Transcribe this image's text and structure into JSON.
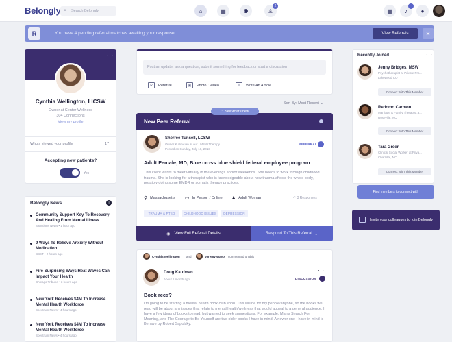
{
  "nav": {
    "logo": "Belongly",
    "search_placeholder": "Search Belongly",
    "referral_badge": "2"
  },
  "banner": {
    "initial": "R",
    "text": "You have 4 pending referral matches awaiting your response",
    "button": "View Referrals",
    "close": "✕"
  },
  "profile": {
    "name": "Cynthia Wellington, LICSW",
    "title": "Owner at Center Wellness",
    "connections": "304 Connections",
    "view_profile": "View my profile",
    "viewed_label": "Who's viewed your profile",
    "viewed_count": "17",
    "accepting_label": "Accepting new patients?",
    "toggle_label": "Yes"
  },
  "news": {
    "title": "Belongly News",
    "items": [
      {
        "title": "Community Support Key To Recovery And Healing From Mental Illness",
        "source": "Sanctions News • 1 hour ago"
      },
      {
        "title": "9 Ways To Relieve Anxiety Without Medication",
        "source": "BBET • 2 hours ago"
      },
      {
        "title": "Fire Surprising Ways Heat Waves Can Impact Your Health",
        "source": "Chicago Tribune • 3 hours ago"
      },
      {
        "title": "New York Receives $4M To Increase Mental Health Workforce",
        "source": "Spectrum News • 4 hours ago"
      },
      {
        "title": "New York Receives $4M To Increase Mental Health Workforce",
        "source": "Spectrum News • 4 hours ago"
      }
    ]
  },
  "composer": {
    "placeholder": "Post an update, ask a question, submit something for feedback or start a discussion",
    "actions": [
      "Referral",
      "Photo / Video",
      "Write An Article"
    ],
    "sort": "Sort By: Most Recent",
    "see_more": "See what's new"
  },
  "referral": {
    "header": "New Peer Referral",
    "author": "Sherree Tunsell, LCSW",
    "author_sub1": "Owner & clinician at our LMSW Therapy",
    "author_sub2": "Posted on Sunday, July 16, 2023",
    "tag": "REFERRAL",
    "headline": "Adult Female, MD, Blue cross blue shield federal employee program",
    "body": "This client wants to meet virtually in the evenings and/or weekends. She needs to work through childhood trauma. She is looking for a therapist who is knowledgeable about how trauma affects the whole body, possibly doing some EMDR or somatic therapy practices.",
    "location": "Massachusetts",
    "mode": "In Person / Online",
    "client": "Adult Woman",
    "responses": "3 Responses",
    "chips": [
      "TRAUMA & PTSD",
      "CHILDHOOD ISSUES",
      "DEPRESSION"
    ],
    "view_details": "View Full Referral Details",
    "respond": "Respond To This Referral"
  },
  "discussion": {
    "commenter1": "Cynthia Wellington",
    "join_word": "and",
    "commenter2": "Jeremy Wayo",
    "commented": "commented on this",
    "author": "Doug Kaufman",
    "author_sub": "About 1 month ago",
    "tag": "DISCUSSION",
    "title": "Book recs?",
    "body": "I'm going to be starting a mental health book club soon. This will be for my people/anyone, so the books we read will be about any issues that relate to mental health/wellness that would appeal to a general audience. I have a few ideas of books to read, but wanted to seek suggestions. For example, Man's Search For Meaning, and The Courage to Be Yourself are two older books I have in mind. A newer one I have in mind is Behave by Robert Sapolsky."
  },
  "recent": {
    "title": "Recently Joined",
    "members": [
      {
        "name": "Jenny Bridges, MSW",
        "role": "Psychotherapist at Private Pra...",
        "location": "Lakewood CO",
        "button": "Connect With This Member"
      },
      {
        "name": "Redomo Carmon",
        "role": "Marriage & Family Therapist a...",
        "location": "Roseville, NC",
        "button": "Connect With This Member"
      },
      {
        "name": "Tara Green",
        "role": "Clinical Social Worker at Priva...",
        "location": "Charlotte, NC",
        "button": "Connect With This Member"
      }
    ],
    "find_button": "Find members to connect with",
    "invite": "Invite your colleagues to join Belongly"
  },
  "colors": {
    "brand": "#3b2d6e",
    "accent": "#5a64c8",
    "banner": "#7f8ed8"
  }
}
